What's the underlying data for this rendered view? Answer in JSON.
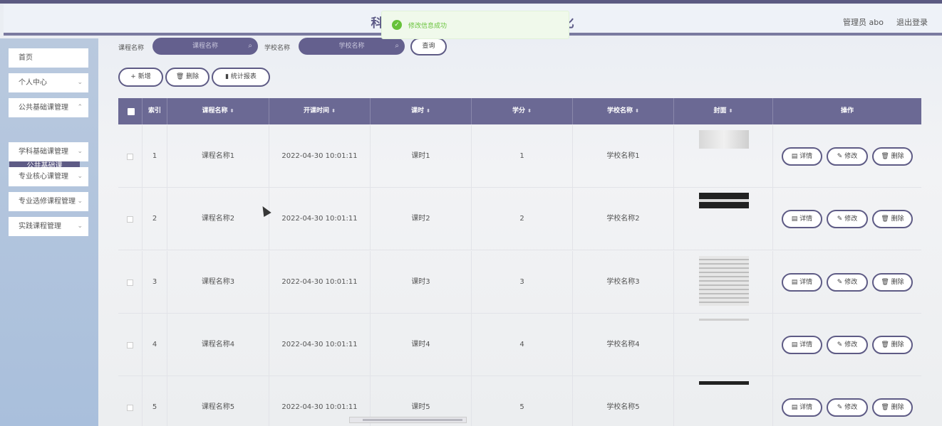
{
  "header": {
    "title_left": "科",
    "title_right": "化",
    "user": "管理员 abo",
    "logout": "退出登录"
  },
  "toast": {
    "text": "修改信息成功",
    "icon": "check-icon"
  },
  "sidebar": {
    "items": [
      {
        "label": "首页"
      },
      {
        "label": "个人中心"
      },
      {
        "label": "公共基础课管理"
      },
      {
        "label": "学科基础课管理"
      },
      {
        "label": "专业核心课管理"
      },
      {
        "label": "专业选修课程管理"
      },
      {
        "label": "实践课程管理"
      }
    ],
    "sub_active": "公共基础课"
  },
  "search": {
    "course_label": "课程名称",
    "course_placeholder": "课程名称",
    "school_label": "学校名称",
    "school_placeholder": "学校名称",
    "query_label": "查询"
  },
  "toolbar": {
    "add_label": "新增",
    "delete_label": "删除",
    "report_label": "统计报表"
  },
  "table": {
    "headers": {
      "index": "索引",
      "course": "课程名称",
      "start": "开课时间",
      "hours": "课时",
      "credit": "学分",
      "school": "学校名称",
      "cover": "封面",
      "ops": "操作"
    },
    "rows": [
      {
        "index": "1",
        "course": "课程名称1",
        "start": "2022-04-30 10:01:11",
        "hours": "课时1",
        "credit": "1",
        "school": "学校名称1"
      },
      {
        "index": "2",
        "course": "课程名称2",
        "start": "2022-04-30 10:01:11",
        "hours": "课时2",
        "credit": "2",
        "school": "学校名称2"
      },
      {
        "index": "3",
        "course": "课程名称3",
        "start": "2022-04-30 10:01:11",
        "hours": "课时3",
        "credit": "3",
        "school": "学校名称3"
      },
      {
        "index": "4",
        "course": "课程名称4",
        "start": "2022-04-30 10:01:11",
        "hours": "课时4",
        "credit": "4",
        "school": "学校名称4"
      },
      {
        "index": "5",
        "course": "课程名称5",
        "start": "2022-04-30 10:01:11",
        "hours": "课时5",
        "credit": "5",
        "school": "学校名称5"
      }
    ],
    "op_detail": "详情",
    "op_edit": "修改",
    "op_delete": "删除"
  },
  "colors": {
    "primary": "#5e5b85",
    "header_bg": "#6b6994",
    "success": "#67c23a"
  }
}
